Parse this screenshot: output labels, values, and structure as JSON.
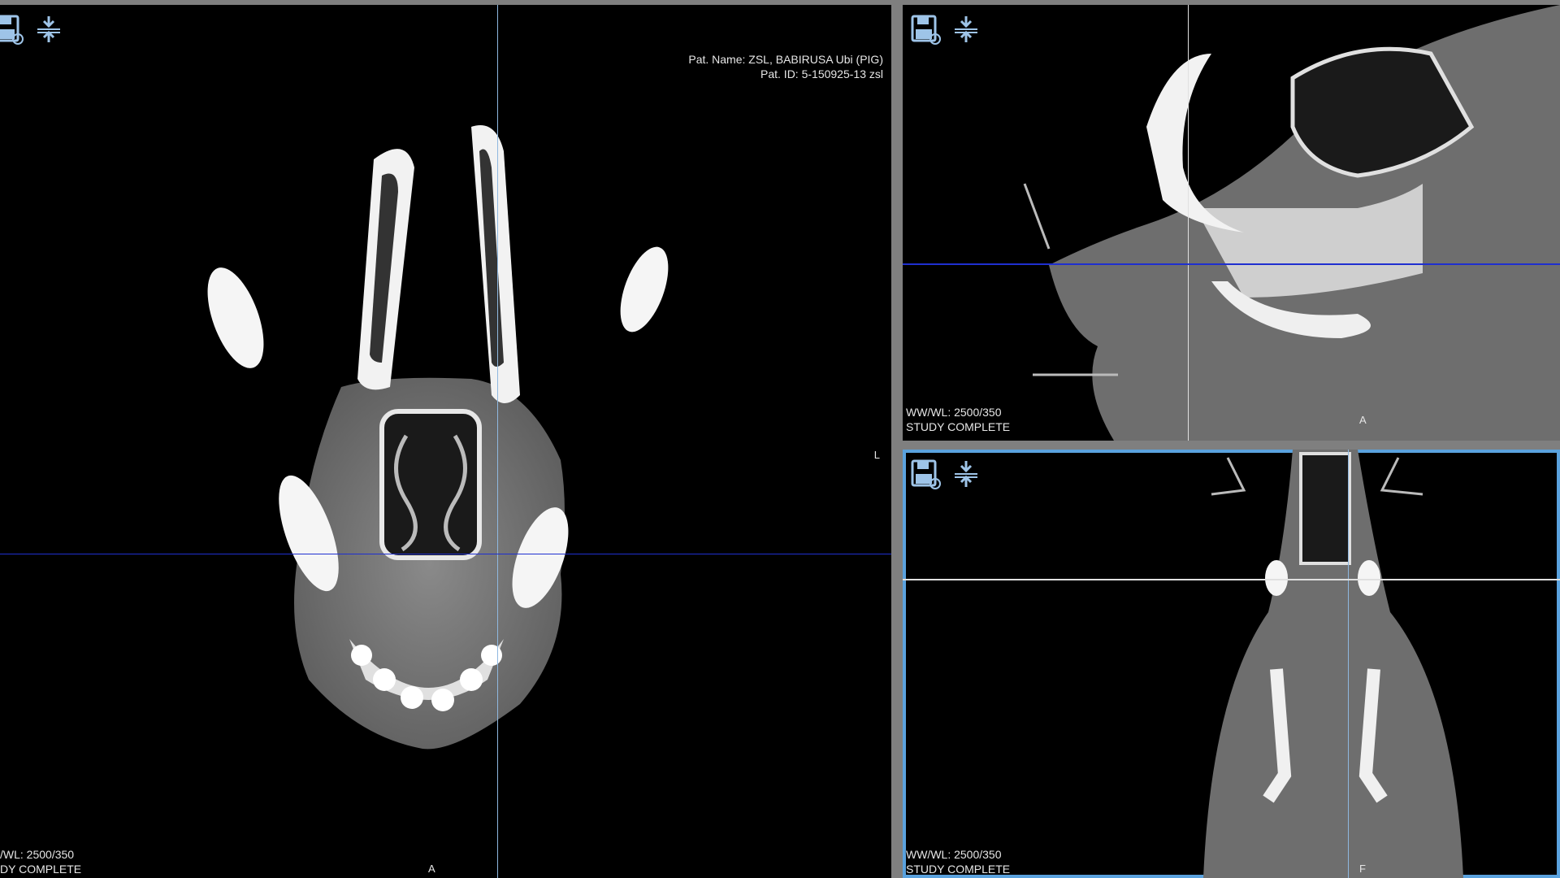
{
  "axial": {
    "pat_name": "Pat. Name: ZSL, BABIRUSA Ubi (PIG)",
    "pat_id": "Pat. ID: 5-150925-13 zsl",
    "wwwl": "/WL: 2500/350",
    "status": "DY COMPLETE",
    "orient_bottom": "A",
    "orient_right": "L"
  },
  "sagittal": {
    "wwwl": "WW/WL: 2500/350",
    "status": "STUDY COMPLETE",
    "orient_bottom": "A"
  },
  "coronal": {
    "wwwl": "WW/WL: 2500/350",
    "status": "STUDY COMPLETE",
    "orient_bottom": "F"
  },
  "icons": {
    "save": "save-icon",
    "sync": "sync-slices-icon"
  },
  "colors": {
    "crosshair_blue": "#1f2fd0",
    "crosshair_light": "#8fb8e0",
    "active_border": "#5aa2de"
  }
}
